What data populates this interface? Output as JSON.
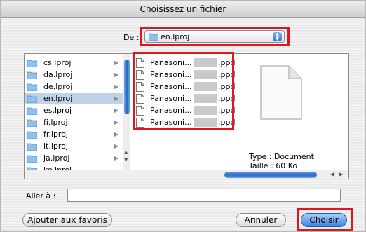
{
  "dialog": {
    "title": "Choisissez un fichier"
  },
  "location": {
    "label": "De :",
    "selected": "en.lproj",
    "icon": "folder-icon"
  },
  "folders": [
    {
      "label": "cs.lproj",
      "selected": false
    },
    {
      "label": "da.lproj",
      "selected": false
    },
    {
      "label": "de.lproj",
      "selected": false
    },
    {
      "label": "en.lproj",
      "selected": true
    },
    {
      "label": "es.lproj",
      "selected": false
    },
    {
      "label": "fi.lproj",
      "selected": false
    },
    {
      "label": "fr.lproj",
      "selected": false
    },
    {
      "label": "it.lproj",
      "selected": false
    },
    {
      "label": "ja.lproj",
      "selected": false
    },
    {
      "label": "ko.lproj",
      "selected": false
    }
  ],
  "files": [
    {
      "prefix": "Panasoni...",
      "ext": ".ppd",
      "selected": true
    },
    {
      "prefix": "Panasoni...",
      "ext": ".ppd",
      "selected": false
    },
    {
      "prefix": "Panasoni...",
      "ext": ".ppd",
      "selected": false
    },
    {
      "prefix": "Panasoni...",
      "ext": ".ppd",
      "selected": false
    },
    {
      "prefix": "Panasoni...",
      "ext": ".ppd",
      "selected": false
    },
    {
      "prefix": "Panasoni...",
      "ext": ".ppd",
      "selected": false
    }
  ],
  "preview": {
    "type": "Type : Document",
    "size": "Taille : 60 Ko"
  },
  "goto": {
    "label": "Aller à :",
    "value": ""
  },
  "buttons": {
    "add_favorites": "Ajouter aux favoris",
    "cancel": "Annuler",
    "choose": "Choisir"
  },
  "colors": {
    "highlight": "#e0161c",
    "selection": "#c2d2e6",
    "accent": "#3c84e0"
  }
}
